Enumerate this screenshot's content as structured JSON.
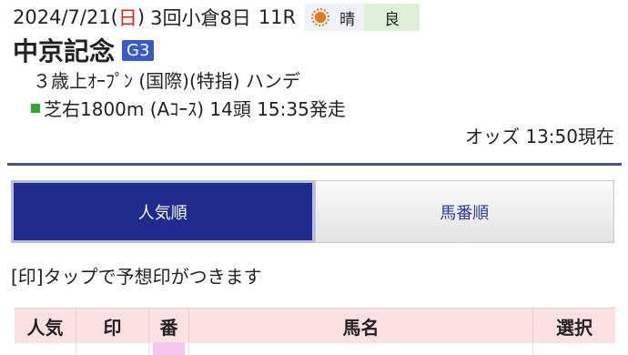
{
  "header": {
    "date_prefix": "2024/7/21(",
    "weekday": "日",
    "date_suffix": ")",
    "meeting": "3回小倉8日",
    "race_no": "11R",
    "weather_icon": "sun-icon",
    "weather": "晴",
    "track_condition": "良"
  },
  "race": {
    "name": "中京記念",
    "grade": "G3",
    "conditions": "３歳上ｵｰﾌﾟﾝ (国際)(特指) ハンデ",
    "course": "芝右1800m (Aｺｰｽ) 14頭 15:35発走",
    "odds_time": "オッズ 13:50現在"
  },
  "tabs": [
    {
      "label": "人気順",
      "active": true
    },
    {
      "label": "馬番順",
      "active": false
    }
  ],
  "hint": "[印]タップで予想印がつきます",
  "table": {
    "columns": [
      "人気",
      "印",
      "番",
      "馬名",
      "選択"
    ]
  },
  "colors": {
    "accent": "#1f2b8d",
    "grade_badge": "#3c59c9",
    "weekday_sunday": "#e0201a",
    "table_header": "#fbe1e1"
  }
}
